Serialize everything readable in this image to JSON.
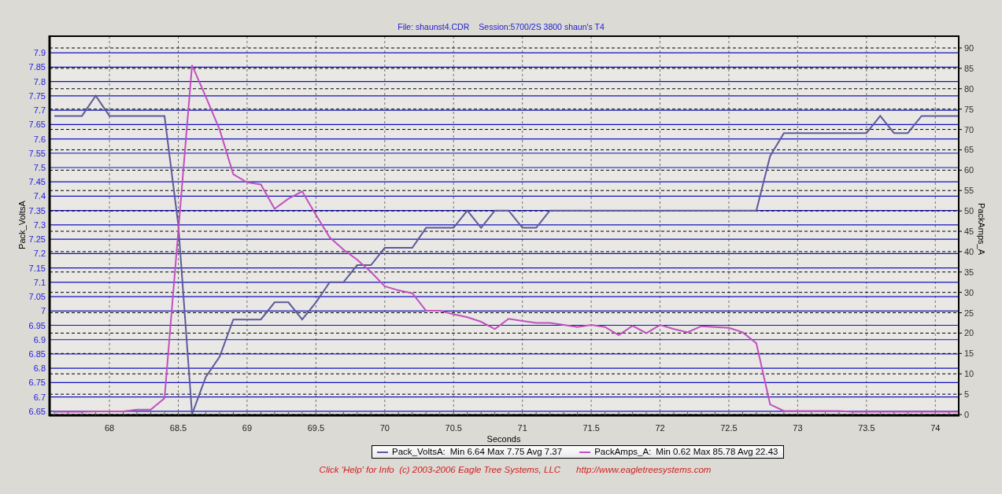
{
  "title": {
    "file": "File: shaunst4.CDR",
    "session": "Session:5700/2S 3800 shaun's T4"
  },
  "chart": {
    "chart_data": {
      "type": "line",
      "grid": true,
      "xlabel": "Seconds",
      "ylabel": "Pack_VoltsA",
      "y2label": "PackAmps_A",
      "xlim": [
        67.565,
        74.17
      ],
      "ylim": [
        6.636,
        7.958
      ],
      "y2lim": [
        -0.19,
        92.9
      ],
      "xticks": [
        68,
        68.5,
        69,
        69.5,
        70,
        70.5,
        71,
        71.5,
        72,
        72.5,
        73,
        73.5,
        74
      ],
      "yticks": [
        6.65,
        6.7,
        6.75,
        6.8,
        6.85,
        6.9,
        6.95,
        7,
        7.05,
        7.1,
        7.15,
        7.2,
        7.25,
        7.3,
        7.35,
        7.4,
        7.45,
        7.5,
        7.55,
        7.6,
        7.65,
        7.7,
        7.75,
        7.8,
        7.85,
        7.9
      ],
      "y2ticks": [
        0,
        5,
        10,
        15,
        20,
        25,
        30,
        35,
        40,
        45,
        50,
        55,
        60,
        65,
        70,
        75,
        80,
        85,
        90
      ],
      "x": [
        67.6,
        67.7,
        67.8,
        67.9,
        68.0,
        68.1,
        68.2,
        68.3,
        68.4,
        68.5,
        68.6,
        68.7,
        68.8,
        68.9,
        69.0,
        69.1,
        69.2,
        69.3,
        69.4,
        69.5,
        69.6,
        69.7,
        69.8,
        69.9,
        70.0,
        70.1,
        70.2,
        70.3,
        70.4,
        70.5,
        70.6,
        70.7,
        70.8,
        70.9,
        71.0,
        71.1,
        71.2,
        71.3,
        71.4,
        71.5,
        71.6,
        71.7,
        71.8,
        71.9,
        72.0,
        72.1,
        72.2,
        72.3,
        72.4,
        72.5,
        72.6,
        72.7,
        72.8,
        72.9,
        73.0,
        73.1,
        73.2,
        73.3,
        73.4,
        73.5,
        73.6,
        73.7,
        73.8,
        73.9,
        74.0,
        74.1,
        74.17
      ],
      "series": [
        {
          "name": "Pack_VoltsA:",
          "color": "#5c5a9c",
          "values": [
            7.68,
            7.68,
            7.68,
            7.75,
            7.68,
            7.68,
            7.68,
            7.68,
            7.68,
            7.3,
            6.64,
            6.77,
            6.84,
            6.97,
            6.97,
            6.97,
            7.03,
            7.03,
            6.97,
            7.03,
            7.1,
            7.1,
            7.16,
            7.16,
            7.22,
            7.22,
            7.22,
            7.29,
            7.29,
            7.29,
            7.35,
            7.29,
            7.35,
            7.35,
            7.29,
            7.29,
            7.35,
            7.35,
            7.35,
            7.35,
            7.35,
            7.35,
            7.35,
            7.35,
            7.35,
            7.35,
            7.35,
            7.35,
            7.35,
            7.35,
            7.35,
            7.35,
            7.54,
            7.62,
            7.62,
            7.62,
            7.62,
            7.62,
            7.62,
            7.62,
            7.68,
            7.62,
            7.62,
            7.68,
            7.68,
            7.68,
            7.68
          ]
        },
        {
          "name": "PackAmps_A:",
          "color": "#c050c0",
          "axis": "y2",
          "values": [
            0.7,
            0.7,
            0.7,
            0.8,
            0.8,
            0.8,
            1.2,
            1.2,
            4,
            45,
            85.8,
            78,
            70,
            59,
            57,
            56.5,
            50.5,
            53,
            54.8,
            49,
            43.5,
            40.5,
            38,
            35,
            31.5,
            30.5,
            29.8,
            25.5,
            25.5,
            24.6,
            23.9,
            22.8,
            21,
            23.5,
            23,
            22.5,
            22.5,
            22,
            21.5,
            22,
            21.5,
            19.5,
            21.8,
            20,
            22,
            21,
            20.2,
            21.7,
            21.5,
            21.3,
            20.2,
            17.5,
            2.5,
            0.9,
            0.9,
            0.9,
            0.9,
            0.9,
            0.7,
            0.7,
            0.7,
            0.7,
            0.7,
            0.7,
            0.7,
            0.7,
            0.7
          ]
        }
      ]
    }
  },
  "legend": [
    {
      "stats": "Min 6.64 Max 7.75 Avg 7.37"
    },
    {
      "stats": "Min 0.62 Max 85.78 Avg 22.43"
    }
  ],
  "footer": {
    "notice": "Click 'Help' for Info  (c) 2003-2006 Eagle Tree Systems, LLC",
    "url": "http://www.eagletreesystems.com"
  }
}
